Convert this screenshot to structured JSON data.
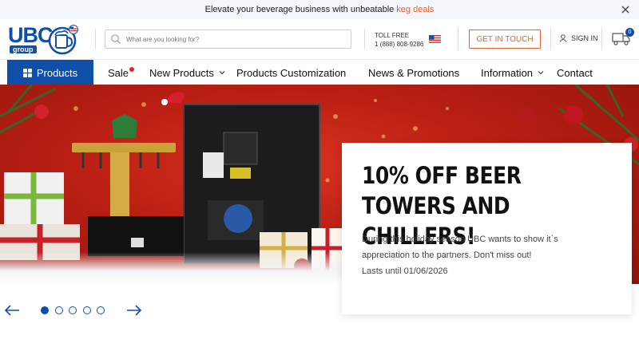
{
  "promo": {
    "text": "Elevate your beverage business with unbeatable",
    "link": "keg deals"
  },
  "header": {
    "logo_text": "UBC",
    "logo_sub": "group",
    "search_placeholder": "What are you looking for?",
    "toll_free_label": "TOLL FREE",
    "toll_free_number": "1 (888) 808-9286",
    "get_in_touch": "GET IN TOUCH",
    "sign_in": "SIGN IN",
    "cart_count": "0"
  },
  "nav": {
    "products": "Products",
    "items": [
      {
        "label": "Sale"
      },
      {
        "label": "New Products"
      },
      {
        "label": "Products Customization"
      },
      {
        "label": "News & Promotions"
      },
      {
        "label": "Information"
      },
      {
        "label": "Contact"
      }
    ]
  },
  "hero": {
    "title": "10% OFF BEER TOWERS AND CHILLERS!",
    "body_line1": "During this holiday season UBC wants to show it`s",
    "body_line2": "appreciation to the partners. Don't miss out!",
    "body_line3": "Lasts until 01/06/2026"
  },
  "carousel": {
    "slide_count": 5,
    "active_index": 0
  },
  "colors": {
    "brand_blue": "#0f4fa8",
    "accent_orange": "#e8612c",
    "sale_red": "#e02424"
  }
}
